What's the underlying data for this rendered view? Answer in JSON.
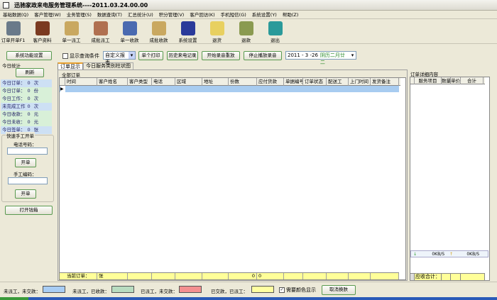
{
  "window": {
    "title": "迅驰家政来电服务管理系统----2011.03.24.00.00"
  },
  "menu": [
    "基础数据(Q)",
    "客户管理(W)",
    "业务管理(S)",
    "数据查询(T)",
    "汇总统计(U)",
    "积分管理(V)",
    "客户回访(K)",
    "手机短信(G)",
    "系统设置(Y)",
    "帮助(Z)"
  ],
  "toolbar": [
    {
      "label": "订单开单F1",
      "icon": "phone-order-icon",
      "color": "#6a7a8a"
    },
    {
      "label": "客户资料",
      "icon": "customer-tv-icon",
      "color": "#7a3a20"
    },
    {
      "label": "单一派工",
      "icon": "dispatch-icon",
      "color": "#c9a860"
    },
    {
      "label": "成批派工",
      "icon": "batch-dispatch-icon",
      "color": "#b07050"
    },
    {
      "label": "单一收款",
      "icon": "payment-icon",
      "color": "#4a6ab0"
    },
    {
      "label": "成批收款",
      "icon": "batch-payment-icon",
      "color": "#c9a860"
    },
    {
      "label": "系统设置",
      "icon": "note-settings-icon",
      "color": "#2a3a9a"
    },
    {
      "label": "退货",
      "icon": "return-pencil-icon",
      "color": "#e8d060"
    },
    {
      "label": "退款",
      "icon": "refund-map-icon",
      "color": "#8a9a50"
    },
    {
      "label": "退出",
      "icon": "exit-door-icon",
      "color": "#2a9a9a"
    }
  ],
  "controls": {
    "sys_func": "系统功能设置",
    "show_query": "显示查询条件",
    "custom_report": "自定义报表",
    "print_single": "单个打印",
    "history_calls": "历史来电记录",
    "start_record": "开始录音重放",
    "stop_record": "停止播放录音",
    "date_value": "2011 - 3  -26",
    "lunar": "阴历二月廿二"
  },
  "left": {
    "today_stats": "今日统计",
    "refresh": "刷新",
    "stats": [
      {
        "label": "今日订单：",
        "value": "0",
        "unit": "次",
        "bg": "#cde0f4"
      },
      {
        "label": "今日订单：",
        "value": "0",
        "unit": "份",
        "bg": "#d8f0d8"
      },
      {
        "label": "今日工作：",
        "value": "0",
        "unit": "次",
        "bg": "#d8f0d8"
      },
      {
        "label": "未完成工作",
        "value": "0",
        "unit": "次",
        "bg": "#cde0f4"
      },
      {
        "label": "今日收款：",
        "value": "0",
        "unit": "元",
        "bg": "#d8f0d8"
      },
      {
        "label": "今日未收：",
        "value": "0",
        "unit": "元",
        "bg": "#d8f0d8"
      },
      {
        "label": "今日签单：",
        "value": "0",
        "unit": "张",
        "bg": "#cde0f4"
      }
    ],
    "quick_title": "快速手工开单",
    "phone_label": "电话号码：",
    "phone_value": "",
    "open1": "开单",
    "manual_label": "手工编码：",
    "manual_value": "",
    "open2": "开单",
    "open_drawer": "打开钱箱"
  },
  "tabs": [
    "订单显示",
    "今日服务类别柱状图"
  ],
  "grid": {
    "title": "全部订单",
    "columns": [
      "时间",
      "客户姓名",
      "客户类型",
      "电话",
      "区域",
      "地址",
      "份数",
      "应付货款",
      "单据编号",
      "订单状态",
      "配送工",
      "上门时间",
      "发货备注"
    ],
    "footer": {
      "label": "当前订单：",
      "unit": "张",
      "qty": "0",
      "amount": "0"
    }
  },
  "detail": {
    "title": "订单详细内容",
    "columns": [
      "服务项目",
      "数量",
      "单价",
      "合计"
    ],
    "net_down": "0KB/S",
    "net_up": "0KB/S",
    "footer": "应收合计："
  },
  "status": {
    "legend": [
      {
        "label": "未派工，未交款：",
        "color": "#a8cdf4"
      },
      {
        "label": "未派工，已收款：",
        "color": "#b8dcc0"
      },
      {
        "label": "已派工，未交款：",
        "color": "#f49090"
      },
      {
        "label": "已交款，已派工：",
        "color": "#ffffa0"
      }
    ],
    "color_display": "需要颜色显示",
    "cancel_skin": "取消换肤"
  }
}
